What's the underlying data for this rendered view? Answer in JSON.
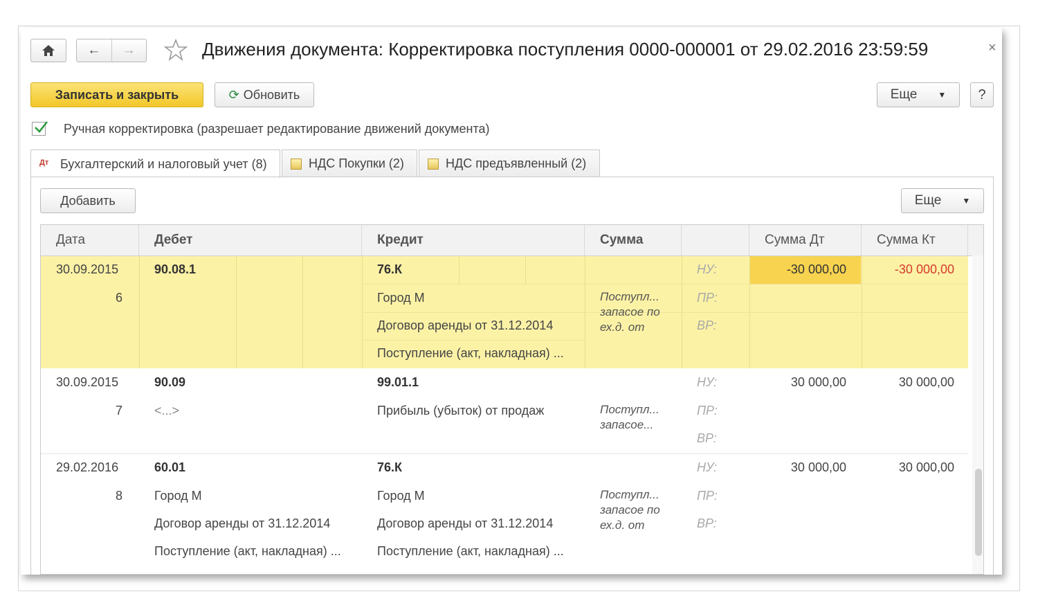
{
  "window": {
    "title": "Движения документа: Корректировка поступления 0000-000001 от 29.02.2016 23:59:59",
    "close": "×"
  },
  "nav": {
    "home": "home-icon",
    "back": "←",
    "forward": "→",
    "favorite": "star-icon"
  },
  "toolbar": {
    "save_close": "Записать и закрыть",
    "refresh": "Обновить",
    "more": "Еще",
    "help": "?"
  },
  "manual_edit": {
    "checked": true,
    "label": "Ручная корректировка (разрешает редактирование движений документа)"
  },
  "tabs": [
    {
      "label": "Бухгалтерский и налоговый учет (8)",
      "active": true
    },
    {
      "label": "НДС Покупки (2)",
      "active": false
    },
    {
      "label": "НДС предъявленный (2)",
      "active": false
    }
  ],
  "table_toolbar": {
    "add": "Добавить",
    "more": "Еще"
  },
  "table": {
    "columns": [
      "Дата",
      "Дебет",
      "Кредит",
      "Сумма",
      "",
      "Сумма Дт",
      "Сумма Кт"
    ],
    "rows": [
      {
        "date": "30.09.2015",
        "number": "6",
        "debit": [
          "90.08.1"
        ],
        "credit": [
          "76.К",
          "Город М",
          "Договор аренды от 31.12.2014",
          "Поступление (акт, накладная) ..."
        ],
        "summa_text": "Поступл... запасое по ех.д. от",
        "labels": [
          "НУ:",
          "ПР:",
          "ВР:"
        ],
        "sum_dt": "-30 000,00",
        "sum_kt": "-30 000,00",
        "selected": true
      },
      {
        "date": "30.09.2015",
        "number": "7",
        "debit": [
          "90.09",
          "<...>"
        ],
        "credit": [
          "99.01.1",
          "Прибыль (убыток) от продаж"
        ],
        "summa_text": "Поступл... запасое...",
        "labels": [
          "НУ:",
          "ПР:",
          "ВР:"
        ],
        "sum_dt": "30 000,00",
        "sum_kt": "30 000,00",
        "selected": false
      },
      {
        "date": "29.02.2016",
        "number": "8",
        "debit": [
          "60.01",
          "Город М",
          "Договор аренды от 31.12.2014",
          "Поступление (акт, накладная) ..."
        ],
        "credit": [
          "76.К",
          "Город М",
          "Договор аренды от 31.12.2014",
          "Поступление (акт, накладная) ..."
        ],
        "summa_text": "Поступл... запасое по ех.д. от",
        "labels": [
          "НУ:",
          "ПР:",
          "ВР:"
        ],
        "sum_dt": "30 000,00",
        "sum_kt": "30 000,00",
        "selected": false
      }
    ]
  },
  "colors": {
    "primary_button": "#f2c728",
    "selected_row": "#fcf2a6",
    "highlight_cell": "#f7d34f",
    "negative": "#d63a2c"
  }
}
